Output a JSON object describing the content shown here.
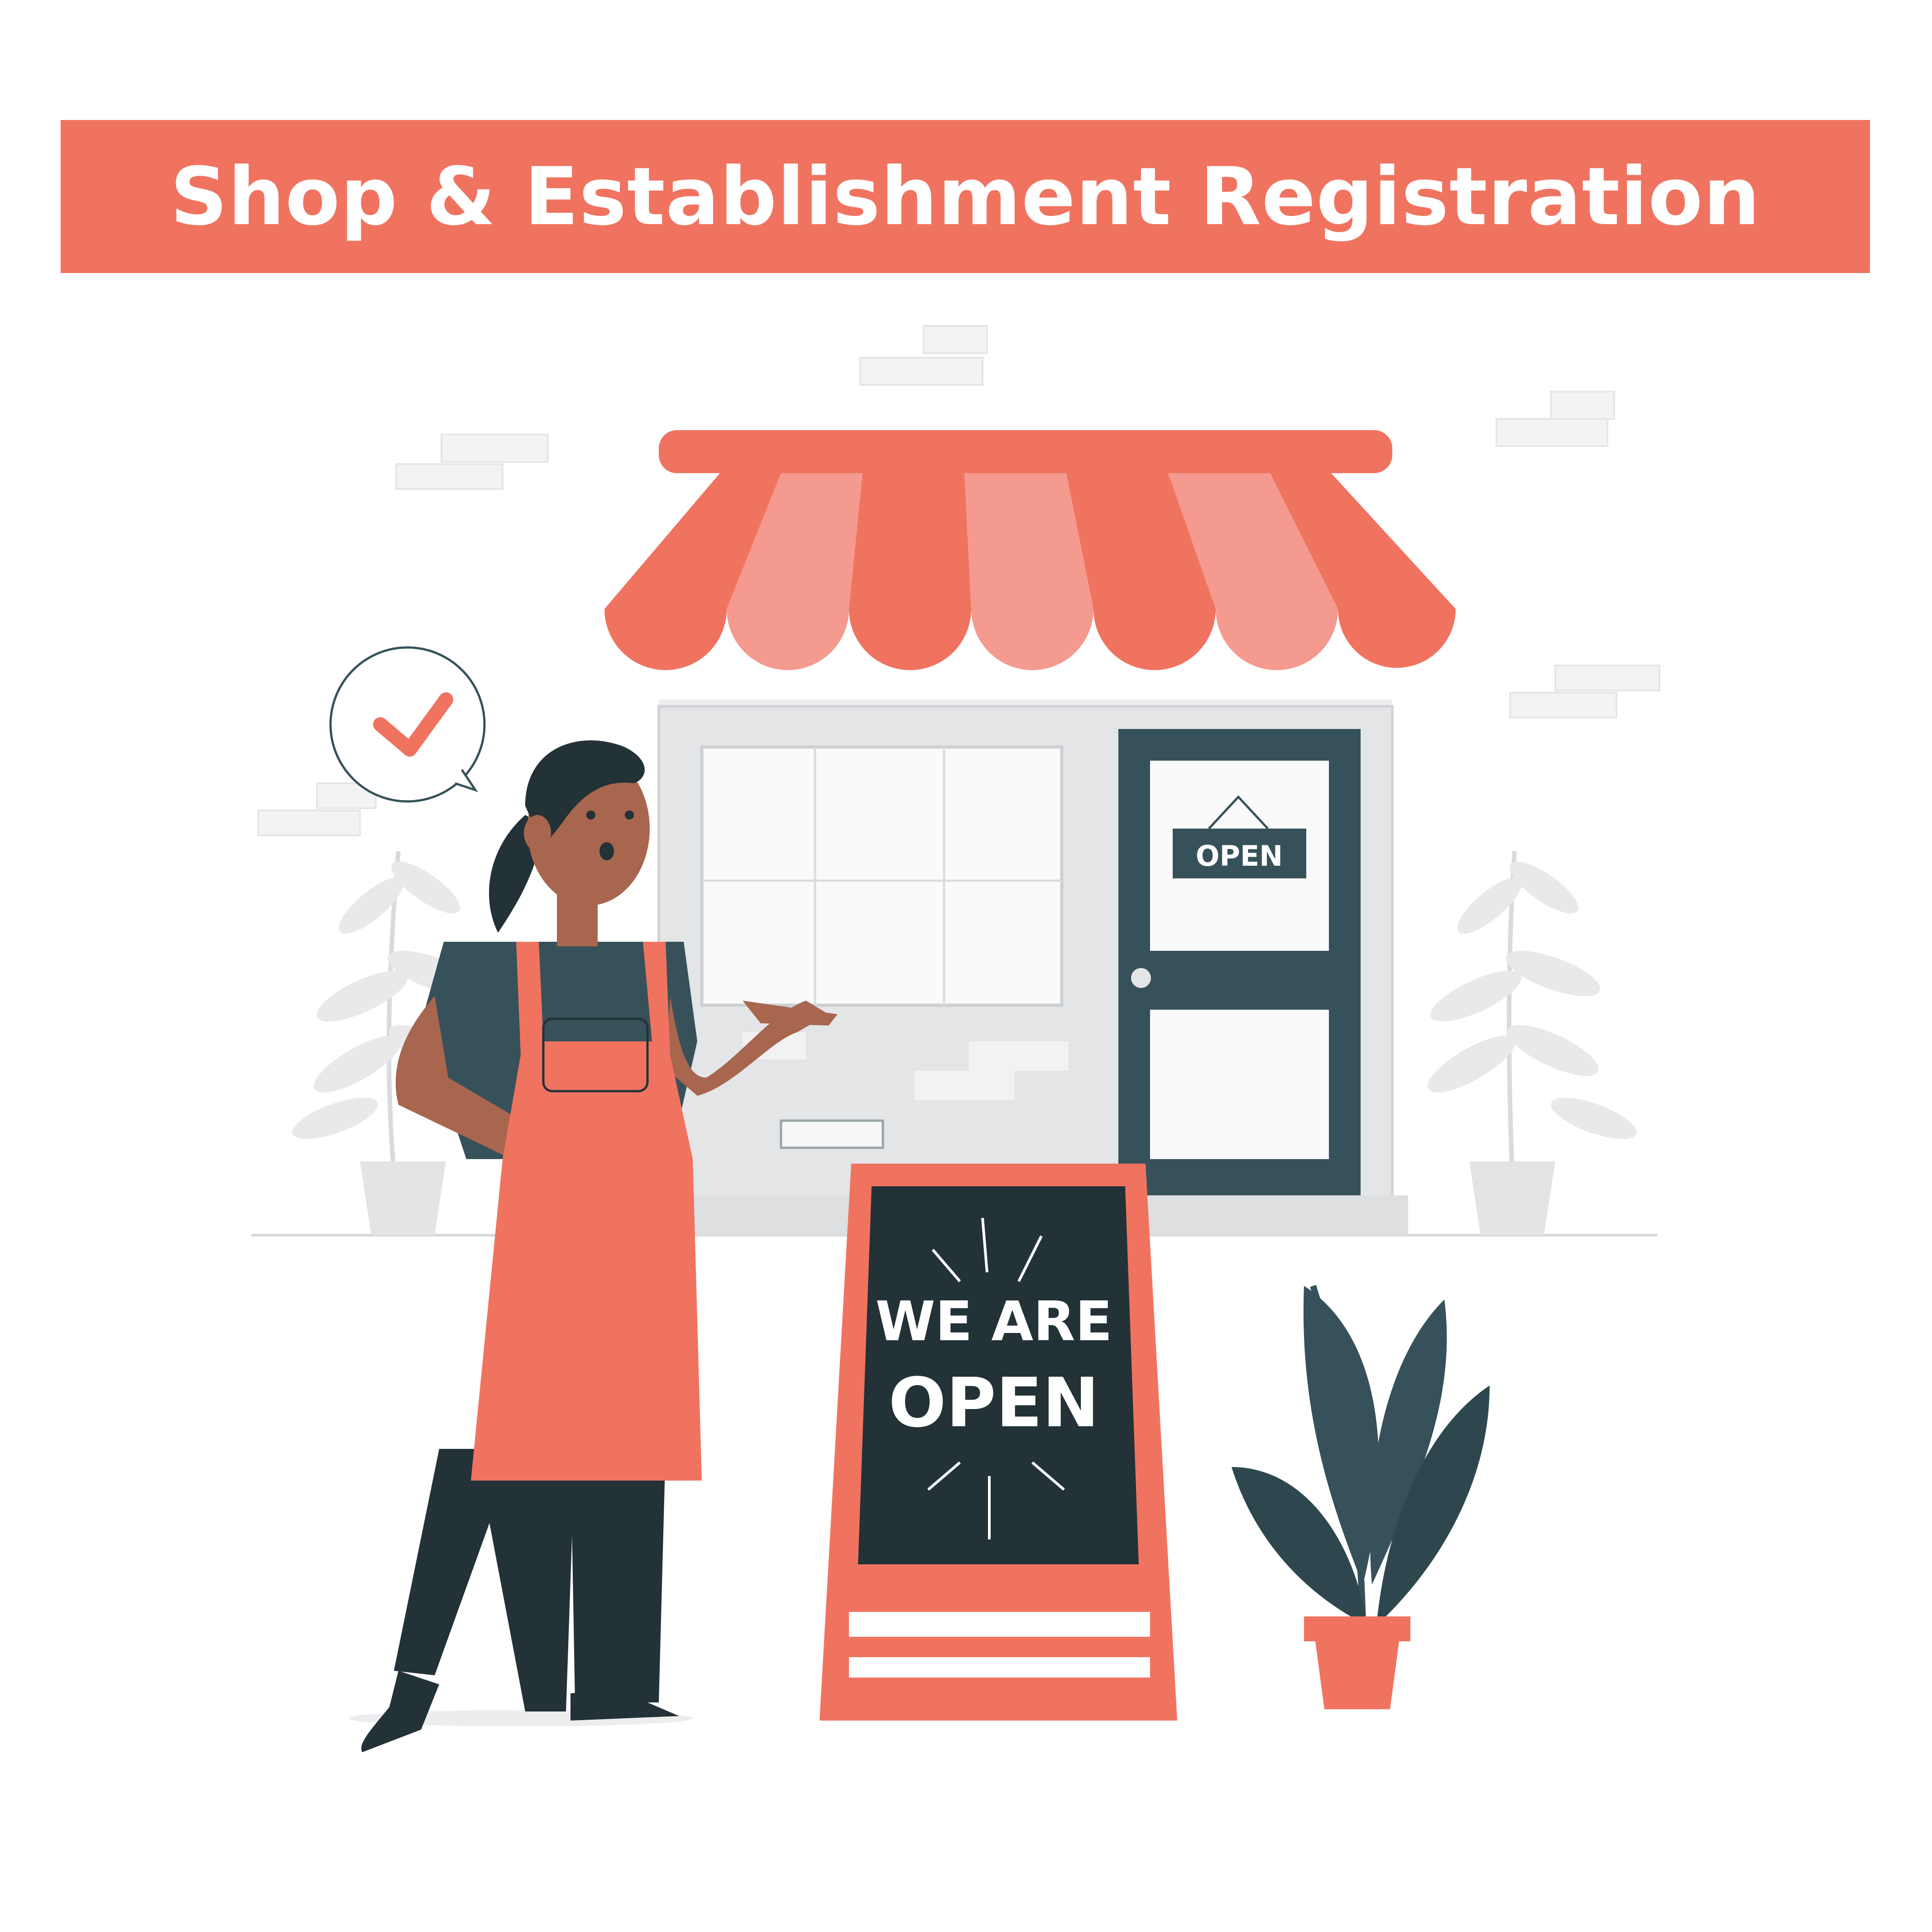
{
  "title": "Shop & Establishment Registration",
  "door_sign": "OPEN",
  "board": {
    "line1": "WE ARE",
    "line2": "OPEN"
  },
  "colors": {
    "accent": "#F07360",
    "accent_light": "#F49A8E",
    "dark_teal": "#37515A",
    "dark": "#223237",
    "wall_gray": "#E4E5E7",
    "skin": "#A8664E",
    "white": "#FFFFFF"
  },
  "icons": [
    "checkmark-icon",
    "speech-bubble-icon"
  ]
}
